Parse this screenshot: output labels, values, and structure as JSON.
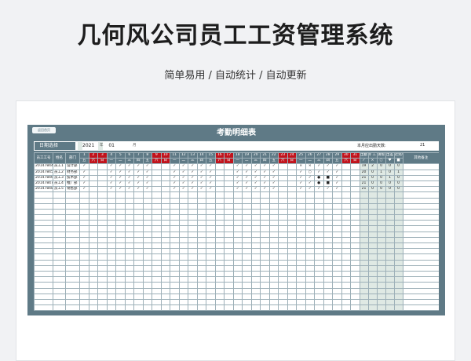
{
  "page": {
    "title": "几何风公司员工工资管理系统",
    "subtitle": "简单易用  /  自动统计  /  自动更新"
  },
  "sheet": {
    "home_label": "返回首页",
    "title": "考勤明细表",
    "date_label": "日期选择",
    "year": "2021",
    "year_unit": "年",
    "month": "01",
    "month_unit": "月",
    "days_label": "本月应出勤天数:",
    "days_value": "21"
  },
  "columns": {
    "emp_id": "员工工号",
    "name": "姓名",
    "dept": "部门",
    "days": [
      "1",
      "2",
      "3",
      "4",
      "5",
      "6",
      "7",
      "8",
      "9",
      "10",
      "11",
      "12",
      "13",
      "14",
      "15",
      "16",
      "17",
      "18",
      "19",
      "20",
      "21",
      "22",
      "23",
      "24",
      "25",
      "26",
      "27",
      "28",
      "29",
      "30",
      "31"
    ],
    "weekdays": [
      "五",
      "六",
      "日",
      "一",
      "二",
      "三",
      "四",
      "五",
      "六",
      "日",
      "一",
      "二",
      "三",
      "四",
      "五",
      "六",
      "日",
      "一",
      "二",
      "三",
      "四",
      "五",
      "六",
      "日",
      "一",
      "二",
      "三",
      "四",
      "五",
      "六",
      "日"
    ],
    "weekend_days": [
      2,
      3,
      9,
      10,
      16,
      17,
      23,
      24,
      30,
      31
    ],
    "stats": [
      "出勤",
      "旷工",
      "请假",
      "出差",
      "迟到/早退"
    ],
    "stats_icons": [
      "✓",
      "×",
      "○",
      "♥",
      "■"
    ],
    "remarks": "其他备注"
  },
  "rows": [
    {
      "id": "20147844",
      "name": "员工1",
      "dept": "设计部",
      "marks": [
        "✓",
        "",
        "",
        "✓",
        "✓",
        "✓",
        "✓",
        "✓",
        "",
        "",
        "✓",
        "✓",
        "✓",
        "✓",
        "✓",
        "",
        "",
        "✓",
        "✓",
        "✓",
        "✓",
        "✓",
        "",
        "",
        "×",
        "×",
        "✓",
        "✓",
        "✓",
        "",
        ""
      ],
      "stats": [
        "19",
        "2",
        "0",
        "0",
        "0"
      ]
    },
    {
      "id": "20147845",
      "name": "员工2",
      "dept": "财务部",
      "marks": [
        "✓",
        "",
        "",
        "✓",
        "✓",
        "✓",
        "✓",
        "✓",
        "",
        "",
        "✓",
        "✓",
        "✓",
        "✓",
        "✓",
        "",
        "",
        "✓",
        "✓",
        "✓",
        "✓",
        "✓",
        "",
        "",
        "✓",
        "○",
        "✓",
        "✓",
        "✓",
        "",
        ""
      ],
      "stats": [
        "20",
        "0",
        "1",
        "0",
        "1"
      ]
    },
    {
      "id": "20147846",
      "name": "员工3",
      "dept": "技术部",
      "marks": [
        "✓",
        "",
        "",
        "✓",
        "✓",
        "✓",
        "✓",
        "✓",
        "",
        "",
        "✓",
        "✓",
        "✓",
        "✓",
        "✓",
        "",
        "",
        "✓",
        "✓",
        "✓",
        "✓",
        "✓",
        "",
        "",
        "✓",
        "✓",
        "●",
        "■",
        "✓",
        "",
        ""
      ],
      "stats": [
        "21",
        "0",
        "0",
        "1",
        "0"
      ]
    },
    {
      "id": "20147847",
      "name": "员工4",
      "dept": "推广部",
      "marks": [
        "✓",
        "",
        "",
        "✓",
        "✓",
        "✓",
        "✓",
        "✓",
        "",
        "",
        "✓",
        "✓",
        "✓",
        "✓",
        "✓",
        "",
        "",
        "✓",
        "✓",
        "✓",
        "✓",
        "✓",
        "",
        "",
        "✓",
        "✓",
        "●",
        "■",
        "✓",
        "",
        ""
      ],
      "stats": [
        "21",
        "0",
        "0",
        "0",
        "0"
      ]
    },
    {
      "id": "20147848",
      "name": "员工5",
      "dept": "销售部",
      "marks": [
        "✓",
        "",
        "",
        "✓",
        "✓",
        "✓",
        "✓",
        "✓",
        "",
        "",
        "✓",
        "✓",
        "✓",
        "✓",
        "✓",
        "",
        "",
        "✓",
        "✓",
        "✓",
        "✓",
        "✓",
        "",
        "",
        "✓",
        "✓",
        "✓",
        "✓",
        "✓",
        "",
        ""
      ],
      "stats": [
        "21",
        "0",
        "0",
        "0",
        "0"
      ]
    }
  ],
  "colors": {
    "header": "#5f7a86",
    "weekend": "#c1131c",
    "stat_fill": "#dfe9e4"
  }
}
